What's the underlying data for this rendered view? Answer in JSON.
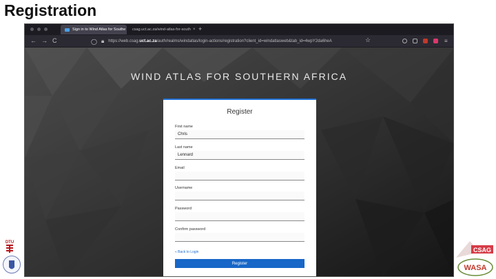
{
  "slide": {
    "title": "Registration"
  },
  "browser": {
    "tabs": [
      {
        "label": "Sign in to Wind Atlas for Southe",
        "close": "×"
      },
      {
        "label": "csag.uct.ac.za/wind-atlas-for-south",
        "close": "×"
      }
    ],
    "new_tab": "+",
    "nav": {
      "back": "←",
      "forward": "→",
      "reload": "C"
    },
    "url": {
      "prefix": "https://web.csag.",
      "domain": "uct.ac.za",
      "suffix": "/auth/realms/windatlas/login-actions/registration?client_id=windatlasweb&tab_id=4wpY2da6heA"
    }
  },
  "page": {
    "site_title": "WIND ATLAS FOR SOUTHERN AFRICA",
    "form": {
      "heading": "Register",
      "fields": [
        {
          "label": "First name",
          "value": "Chris"
        },
        {
          "label": "Last name",
          "value": "Lennard"
        },
        {
          "label": "Email",
          "value": ""
        },
        {
          "label": "Username",
          "value": ""
        },
        {
          "label": "Password",
          "value": ""
        },
        {
          "label": "Confirm password",
          "value": ""
        }
      ],
      "back_link": "« Back to Login",
      "submit": "Register"
    }
  },
  "logos": {
    "dtu": "DTU",
    "csag": "CSAG",
    "wasa": "WASA"
  },
  "colors": {
    "accent": "#1766c8",
    "browser_bg": "#2b2a33"
  }
}
